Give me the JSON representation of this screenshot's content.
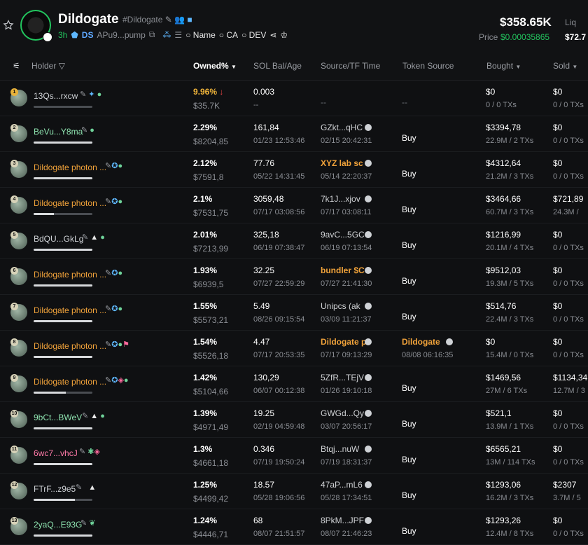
{
  "header": {
    "token_name": "Dildogate",
    "token_tag": "#Dildogate",
    "age": "3h",
    "ds_label": "DS",
    "address": "APu9...pump",
    "search_name": "Name",
    "search_ca": "CA",
    "search_dev": "DEV",
    "market_cap": "$358.65K",
    "price_label": "Price",
    "price_value": "$0.00035865",
    "liq_label": "Liq",
    "liq_value": "$72.7"
  },
  "columns": {
    "holder": "Holder",
    "owned": "Owned%",
    "sol_bal_age": "SOL Bal/Age",
    "source_tf_time": "Source/TF Time",
    "token_source": "Token Source",
    "bought": "Bought",
    "sold": "Sold"
  },
  "rows": [
    {
      "rank": "1",
      "holder": "13Qs...rxcw",
      "owned": "9.96%",
      "owned_usd": "$35.7K",
      "sol": "0.003",
      "sol_age": "--",
      "source": "--",
      "source_time": "",
      "token_source": "--",
      "token_source_time": "",
      "action": "",
      "bought": "$0",
      "bought_sub": "0 / 0 TXs",
      "sold": "$0",
      "sold_sub": "0 / 0 TXs",
      "bar": 0.0
    },
    {
      "rank": "2",
      "holder": "BeVu...Y8ma",
      "owned": "2.29%",
      "owned_usd": "$8204,85",
      "sol": "161,84",
      "sol_age": "01/23 12:53:46",
      "source": "GZkt...qHC",
      "source_time": "02/15 20:42:31",
      "token_source": "",
      "token_source_time": "",
      "action": "Buy",
      "bought": "$3394,78",
      "bought_sub": "22.9M / 2 TXs",
      "sold": "$0",
      "sold_sub": "0 / 0 TXs",
      "bar": 1.0
    },
    {
      "rank": "3",
      "holder": "Dildogate photon ...",
      "owned": "2.12%",
      "owned_usd": "$7591,8",
      "sol": "77.76",
      "sol_age": "05/22 14:31:45",
      "source": "XYZ lab sc",
      "source_time": "05/14 22:20:37",
      "token_source": "",
      "token_source_time": "",
      "action": "Buy",
      "bought": "$4312,64",
      "bought_sub": "21.2M / 3 TXs",
      "sold": "$0",
      "sold_sub": "0 / 0 TXs",
      "bar": 1.0
    },
    {
      "rank": "4",
      "holder": "Dildogate photon ...",
      "owned": "2.1%",
      "owned_usd": "$7531,75",
      "sol": "3059,48",
      "sol_age": "07/17 03:08:56",
      "source": "7k1J...xjov",
      "source_time": "07/17 03:08:11",
      "token_source": "",
      "token_source_time": "",
      "action": "Buy",
      "bought": "$3464,66",
      "bought_sub": "60.7M / 3 TXs",
      "sold": "$721,89",
      "sold_sub": "24.3M /",
      "bar": 0.35
    },
    {
      "rank": "5",
      "holder": "BdQU...GkLg",
      "owned": "2.01%",
      "owned_usd": "$7213,99",
      "sol": "325,18",
      "sol_age": "06/19 07:38:47",
      "source": "9avC...5GC",
      "source_time": "06/19 07:13:54",
      "token_source": "",
      "token_source_time": "",
      "action": "Buy",
      "bought": "$1216,99",
      "bought_sub": "20.1M / 4 TXs",
      "sold": "$0",
      "sold_sub": "0 / 0 TXs",
      "bar": 1.0
    },
    {
      "rank": "6",
      "holder": "Dildogate photon ...",
      "owned": "1.93%",
      "owned_usd": "$6939,5",
      "sol": "32.25",
      "sol_age": "07/27 22:59:29",
      "source": "bundler $C",
      "source_time": "07/27 21:41:30",
      "token_source": "",
      "token_source_time": "",
      "action": "Buy",
      "bought": "$9512,03",
      "bought_sub": "19.3M / 5 TXs",
      "sold": "$0",
      "sold_sub": "0 / 0 TXs",
      "bar": 1.0
    },
    {
      "rank": "7",
      "holder": "Dildogate photon ...",
      "owned": "1.55%",
      "owned_usd": "$5573,21",
      "sol": "5.49",
      "sol_age": "08/26 09:15:54",
      "source": "Unipcs (ak",
      "source_time": "03/09 11:21:37",
      "token_source": "",
      "token_source_time": "",
      "action": "Buy",
      "bought": "$514,76",
      "bought_sub": "22.4M / 3 TXs",
      "sold": "$0",
      "sold_sub": "0 / 0 TXs",
      "bar": 1.0
    },
    {
      "rank": "8",
      "holder": "Dildogate photon ...",
      "owned": "1.54%",
      "owned_usd": "$5526,18",
      "sol": "4.47",
      "sol_age": "07/17 20:53:35",
      "source": "Dildogate p",
      "source_time": "07/17 09:13:29",
      "token_source": "Dildogate p",
      "token_source_time": "08/08 06:16:35",
      "action": "",
      "bought": "$0",
      "bought_sub": "15.4M / 0 TXs",
      "sold": "$0",
      "sold_sub": "0 / 0 TXs",
      "bar": 1.0
    },
    {
      "rank": "9",
      "holder": "Dildogate photon ...",
      "owned": "1.42%",
      "owned_usd": "$5104,66",
      "sol": "130,29",
      "sol_age": "06/07 00:12:38",
      "source": "5ZfR...TEjV",
      "source_time": "01/26 19:10:18",
      "token_source": "",
      "token_source_time": "",
      "action": "Buy",
      "bought": "$1469,56",
      "bought_sub": "27M / 6 TXs",
      "sold": "$1134,34",
      "sold_sub": "12.7M / 3",
      "bar": 0.55
    },
    {
      "rank": "10",
      "holder": "9bCt...BWeV",
      "owned": "1.39%",
      "owned_usd": "$4971,49",
      "sol": "19.25",
      "sol_age": "02/19 04:59:48",
      "source": "GWGd...Qy",
      "source_time": "03/07 20:56:17",
      "token_source": "",
      "token_source_time": "",
      "action": "Buy",
      "bought": "$521,1",
      "bought_sub": "13.9M / 1 TXs",
      "sold": "$0",
      "sold_sub": "0 / 0 TXs",
      "bar": 1.0
    },
    {
      "rank": "11",
      "holder": "6wc7...vhcJ",
      "owned": "1.3%",
      "owned_usd": "$4661,18",
      "sol": "0.346",
      "sol_age": "07/19 19:50:24",
      "source": "Btqj...nuW",
      "source_time": "07/19 18:31:37",
      "token_source": "",
      "token_source_time": "",
      "action": "Buy",
      "bought": "$6565,21",
      "bought_sub": "13M / 114 TXs",
      "sold": "$0",
      "sold_sub": "0 / 0 TXs",
      "bar": 1.0
    },
    {
      "rank": "12",
      "holder": "FTrF...z9e5",
      "owned": "1.25%",
      "owned_usd": "$4499,42",
      "sol": "18.57",
      "sol_age": "05/28 19:06:56",
      "source": "47aP...mL6",
      "source_time": "05/28 17:34:51",
      "token_source": "",
      "token_source_time": "",
      "action": "Buy",
      "bought": "$1293,06",
      "bought_sub": "16.2M / 3 TXs",
      "sold": "$2307",
      "sold_sub": "3.7M / 5",
      "bar": 0.7
    },
    {
      "rank": "13",
      "holder": "2yaQ...E93G",
      "owned": "1.24%",
      "owned_usd": "$4446,71",
      "sol": "68",
      "sol_age": "08/07 21:51:57",
      "source": "8PkM...JPF",
      "source_time": "08/07 21:46:23",
      "token_source": "",
      "token_source_time": "",
      "action": "Buy",
      "bought": "$1293,26",
      "bought_sub": "12.4M / 8 TXs",
      "sold": "$0",
      "sold_sub": "0 / 0 TXs",
      "bar": 1.0
    }
  ]
}
